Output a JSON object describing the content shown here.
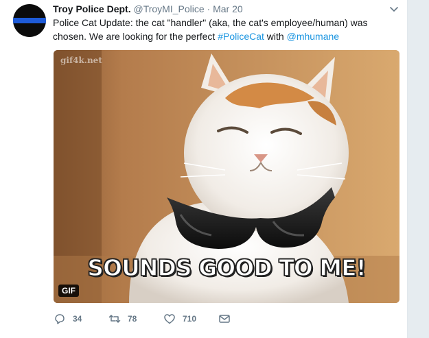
{
  "tweet": {
    "author": {
      "name": "Troy Police Dept.",
      "handle": "@TroyMI_Police",
      "separator": "·",
      "time": "Mar 20"
    },
    "text": {
      "part1": "Police Cat Update:  the cat \"handler\" (aka, the cat's employee/human) was chosen.  We are looking for the perfect ",
      "hashtag": "#PoliceCat",
      "part2": " with ",
      "mention": "@mhumane"
    },
    "media": {
      "watermark": "gif4k.net",
      "caption": "SOUNDS GOOD TO ME!",
      "badge": "GIF"
    },
    "actions": {
      "replies": "34",
      "retweets": "78",
      "likes": "710"
    },
    "colors": {
      "link": "#1b95e0",
      "muted": "#657786",
      "avatar_stripe": "#1e5bd8"
    },
    "icons": [
      "chevron-down-icon",
      "reply-icon",
      "retweet-icon",
      "like-icon",
      "message-icon"
    ]
  }
}
